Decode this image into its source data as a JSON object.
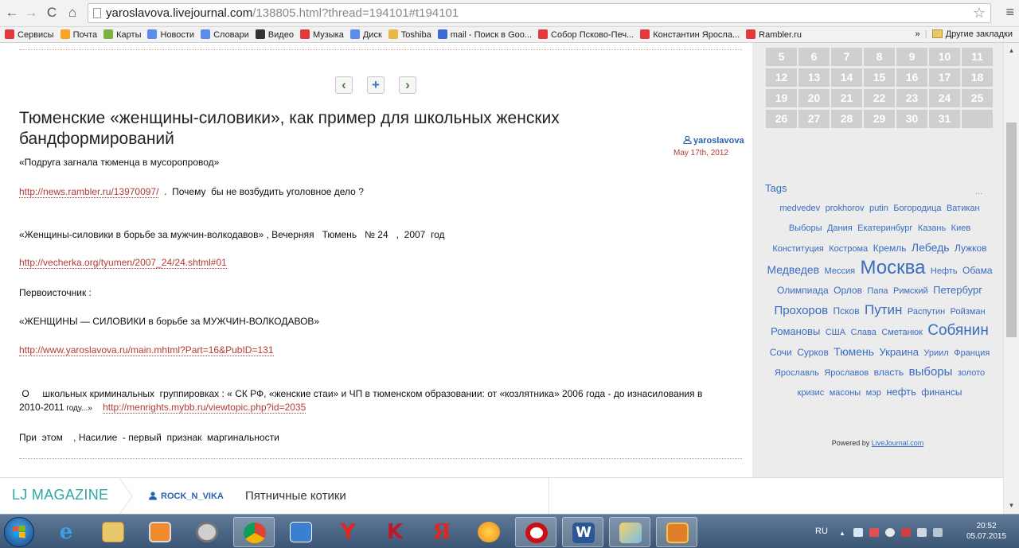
{
  "browser": {
    "url_host": "yaroslavova.livejournal.com",
    "url_path": "/138805.html?thread=194101#t194101",
    "bookmarks": [
      {
        "label": "Сервисы",
        "color": "#e4393c"
      },
      {
        "label": "Почта",
        "color": "#f5a623"
      },
      {
        "label": "Карты",
        "color": "#7cb342"
      },
      {
        "label": "Новости",
        "color": "#5b8def"
      },
      {
        "label": "Словари",
        "color": "#5b8def"
      },
      {
        "label": "Видео",
        "color": "#333333"
      },
      {
        "label": "Музыка",
        "color": "#e4393c"
      },
      {
        "label": "Диск",
        "color": "#5b8def"
      },
      {
        "label": "Toshiba",
        "color": "#e8b84a"
      },
      {
        "label": "mail - Поиск в Goo...",
        "color": "#3a6cd8"
      },
      {
        "label": "Собор Псково-Печ...",
        "color": "#e4393c"
      },
      {
        "label": "Константин Яросла...",
        "color": "#e4393c"
      },
      {
        "label": "Rambler.ru",
        "color": "#e4393c"
      }
    ],
    "overflow_label": "»",
    "other_bookmarks": "Другие закладки"
  },
  "post": {
    "title": "Тюменские «женщины-силовики», как пример для школьных женских бандформирований",
    "author": "yaroslavova",
    "date": "May 17th, 2012",
    "para1": "«Подруга загнала тюменца в мусоропровод»",
    "link1": "http://news.rambler.ru/13970097/",
    "para2_rest": "  .  Почему  бы не возбудить уголовное дело ?",
    "para3": "«Женщины-силовики в борьбе за мужчин-волкодавов» , Вечерняя   Тюмень   № 24   ,  2007  год",
    "link2": "http://vecherka.org/tyumen/2007_24/24.shtml#01",
    "para4": "Первоисточник :",
    "para5": "«ЖЕНЩИНЫ — СИЛОВИКИ в борьбе за МУЖЧИН-ВОЛКОДАВОВ»",
    "link3": "http://www.yaroslavova.ru/main.mhtml?Part=16&PubID=131",
    "para6_line1": " О     школьных криминальных  группировках : « СК РФ, «женские стаи» и ЧП в тюменском образовании: от «козлятника» 2006 года - до изнасилования в",
    "para6_line2_text": "2010-2011",
    "para6_line2_small": " году...»",
    "link4": "http://menrights.mybb.ru/viewtopic.php?id=2035",
    "para7": "При  этом    , Насилие  - первый  признак  маргинальности"
  },
  "sidebar": {
    "calendar_rows": [
      [
        "5",
        "6",
        "7",
        "8",
        "9",
        "10",
        "11"
      ],
      [
        "12",
        "13",
        "14",
        "15",
        "16",
        "17",
        "18"
      ],
      [
        "19",
        "20",
        "21",
        "22",
        "23",
        "24",
        "25"
      ],
      [
        "26",
        "27",
        "28",
        "29",
        "30",
        "31",
        ""
      ]
    ],
    "tags_title": "Tags",
    "tags_more": "...",
    "tags": [
      {
        "t": "medvedev",
        "s": 11
      },
      {
        "t": "prokhorov",
        "s": 11
      },
      {
        "t": "putin",
        "s": 11
      },
      {
        "t": "Богородица",
        "s": 11
      },
      {
        "t": "Ватикан",
        "s": 11
      },
      {
        "t": "Выборы",
        "s": 11
      },
      {
        "t": "Дания",
        "s": 11
      },
      {
        "t": "Екатеринбург",
        "s": 11
      },
      {
        "t": "Казань",
        "s": 11
      },
      {
        "t": "Киев",
        "s": 11
      },
      {
        "t": "Конституция",
        "s": 11
      },
      {
        "t": "Кострома",
        "s": 11
      },
      {
        "t": "Кремль",
        "s": 12
      },
      {
        "t": "Лебедь",
        "s": 14
      },
      {
        "t": "Лужков",
        "s": 12
      },
      {
        "t": "Медведев",
        "s": 14
      },
      {
        "t": "Мессия",
        "s": 11
      },
      {
        "t": "Москва",
        "s": 24
      },
      {
        "t": "Нефть",
        "s": 11
      },
      {
        "t": "Обама",
        "s": 12
      },
      {
        "t": "Олимпиада",
        "s": 12
      },
      {
        "t": "Орлов",
        "s": 12
      },
      {
        "t": "Папа",
        "s": 11
      },
      {
        "t": "Римский",
        "s": 11
      },
      {
        "t": "Петербург",
        "s": 13
      },
      {
        "t": "Прохоров",
        "s": 15
      },
      {
        "t": "Псков",
        "s": 12
      },
      {
        "t": "Путин",
        "s": 17
      },
      {
        "t": "Распутин",
        "s": 11
      },
      {
        "t": "Ройзман",
        "s": 11
      },
      {
        "t": "Романовы",
        "s": 13
      },
      {
        "t": "США",
        "s": 11
      },
      {
        "t": "Слава",
        "s": 11
      },
      {
        "t": "Сметанюк",
        "s": 11
      },
      {
        "t": "Собянин",
        "s": 19
      },
      {
        "t": "Сочи",
        "s": 12
      },
      {
        "t": "Сурков",
        "s": 12
      },
      {
        "t": "Тюмень",
        "s": 14
      },
      {
        "t": "Украина",
        "s": 13
      },
      {
        "t": "Уриил",
        "s": 11
      },
      {
        "t": "Франция",
        "s": 11
      },
      {
        "t": "Ярославль",
        "s": 11
      },
      {
        "t": "Ярославов",
        "s": 11
      },
      {
        "t": "власть",
        "s": 12
      },
      {
        "t": "выборы",
        "s": 15
      },
      {
        "t": "золото",
        "s": 11
      },
      {
        "t": "кризис",
        "s": 11
      },
      {
        "t": "масоны",
        "s": 11
      },
      {
        "t": "мэр",
        "s": 11
      },
      {
        "t": "нефть",
        "s": 13
      },
      {
        "t": "финансы",
        "s": 12
      }
    ],
    "powered_prefix": "Powered by",
    "powered_link": "LiveJournal.com"
  },
  "ljbar": {
    "magazine": "LJ MAGAZINE",
    "user": "ROCK_N_VIKA",
    "post_title": "Пятничные котики"
  },
  "taskbar": {
    "lang": "RU",
    "time": "20:52",
    "date": "05.07.2015"
  },
  "colors": {
    "link": "#b33a3a",
    "tag": "#3a6cc0",
    "lj_magazine": "#2ea6a0",
    "calendar_cell": "#cfcfcf"
  }
}
